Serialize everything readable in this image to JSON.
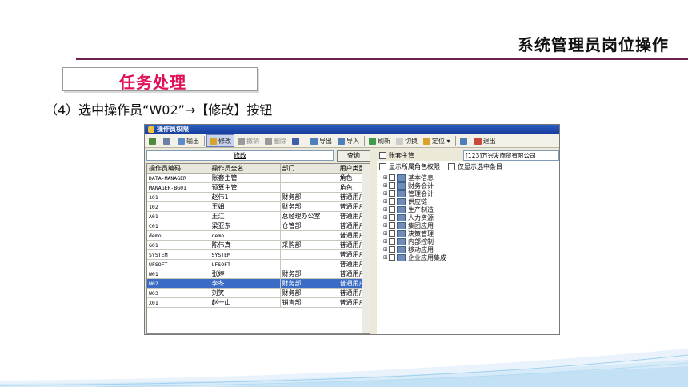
{
  "slide": {
    "title": "系统管理员岗位操作",
    "task_label": "任务处理",
    "instruction": "（4）选中操作员“W02”→【修改】按钮"
  },
  "window": {
    "title": "操作员权限",
    "toolbar": [
      {
        "label": "",
        "icon": "undo-icon",
        "color": "#4f8a3c",
        "state": "normal"
      },
      {
        "label": "",
        "icon": "print-icon",
        "color": "#6d7fa3",
        "state": "normal"
      },
      {
        "label": "输出",
        "icon": "export-icon",
        "color": "#5d8bc8",
        "state": "normal"
      },
      {
        "label": "修改",
        "icon": "edit-icon",
        "color": "#d8a32a",
        "state": "active"
      },
      {
        "label": "撤销",
        "icon": "revoke-icon",
        "color": "#9a9a9a",
        "state": "disabled"
      },
      {
        "label": "删除",
        "icon": "delete-icon",
        "color": "#9a9a9a",
        "state": "disabled"
      },
      {
        "label": "",
        "icon": "save-icon",
        "color": "#3d5fa8",
        "state": "normal"
      },
      {
        "label": "导出",
        "icon": "export-data-icon",
        "color": "#4f7fb8",
        "state": "normal"
      },
      {
        "label": "导入",
        "icon": "import-icon",
        "color": "#4f7fb8",
        "state": "normal"
      },
      {
        "label": "刷新",
        "icon": "refresh-icon",
        "color": "#3f9a4a",
        "state": "normal"
      },
      {
        "label": "切换",
        "icon": "switch-icon",
        "color": "#cccccc",
        "state": "normal"
      },
      {
        "label": "定位 ▾",
        "icon": "locate-icon",
        "color": "#d8a32a",
        "state": "normal"
      },
      {
        "label": "",
        "icon": "help-icon",
        "color": "#4f7fb8",
        "state": "normal"
      },
      {
        "label": "退出",
        "icon": "exit-icon",
        "color": "#c84a3a",
        "state": "normal"
      }
    ],
    "filter": {
      "value": "修改",
      "query_label": "查询"
    },
    "grid": {
      "columns": [
        "操作员编码",
        "操作员全名",
        "部门",
        "用户类型"
      ],
      "rows": [
        [
          "DATA-MANAGER",
          "账套主管",
          "",
          "角色"
        ],
        [
          "MANAGER-BG01",
          "预算主管",
          "",
          "角色"
        ],
        [
          "101",
          "赵伟1",
          "财务部",
          "普通用户"
        ],
        [
          "102",
          "王娟",
          "财务部",
          "普通用户"
        ],
        [
          "A01",
          "王江",
          "总经理办公室",
          "普通用户"
        ],
        [
          "C01",
          "梁亚东",
          "仓管部",
          "普通用户"
        ],
        [
          "demo",
          "demo",
          "",
          "普通用户"
        ],
        [
          "G01",
          "陈伟真",
          "采购部",
          "普通用户"
        ],
        [
          "SYSTEM",
          "SYSTEM",
          "",
          "普通用户"
        ],
        [
          "UFSOFT",
          "UFSOFT",
          "",
          "普通用户"
        ],
        [
          "W01",
          "张婷",
          "财务部",
          "普通用户"
        ],
        [
          "W02",
          "李冬",
          "财务部",
          "普通用户"
        ],
        [
          "W03",
          "刘笑",
          "财务部",
          "普通用户"
        ],
        [
          "X01",
          "赵一山",
          "销售部",
          "普通用户"
        ]
      ],
      "selected_row": 11
    },
    "right_panel": {
      "account_manager_label": "账套主管",
      "company": "[123]万兴发商贸有限公司",
      "show_role_perm_label": "显示所属角色权限",
      "show_selected_only_label": "仅显示选中条目",
      "tree": [
        "基本信息",
        "财务会计",
        "管理会计",
        "供应链",
        "生产制造",
        "人力资源",
        "集团应用",
        "决策管理",
        "内部控制",
        "移动应用",
        "企业应用集成"
      ]
    }
  }
}
